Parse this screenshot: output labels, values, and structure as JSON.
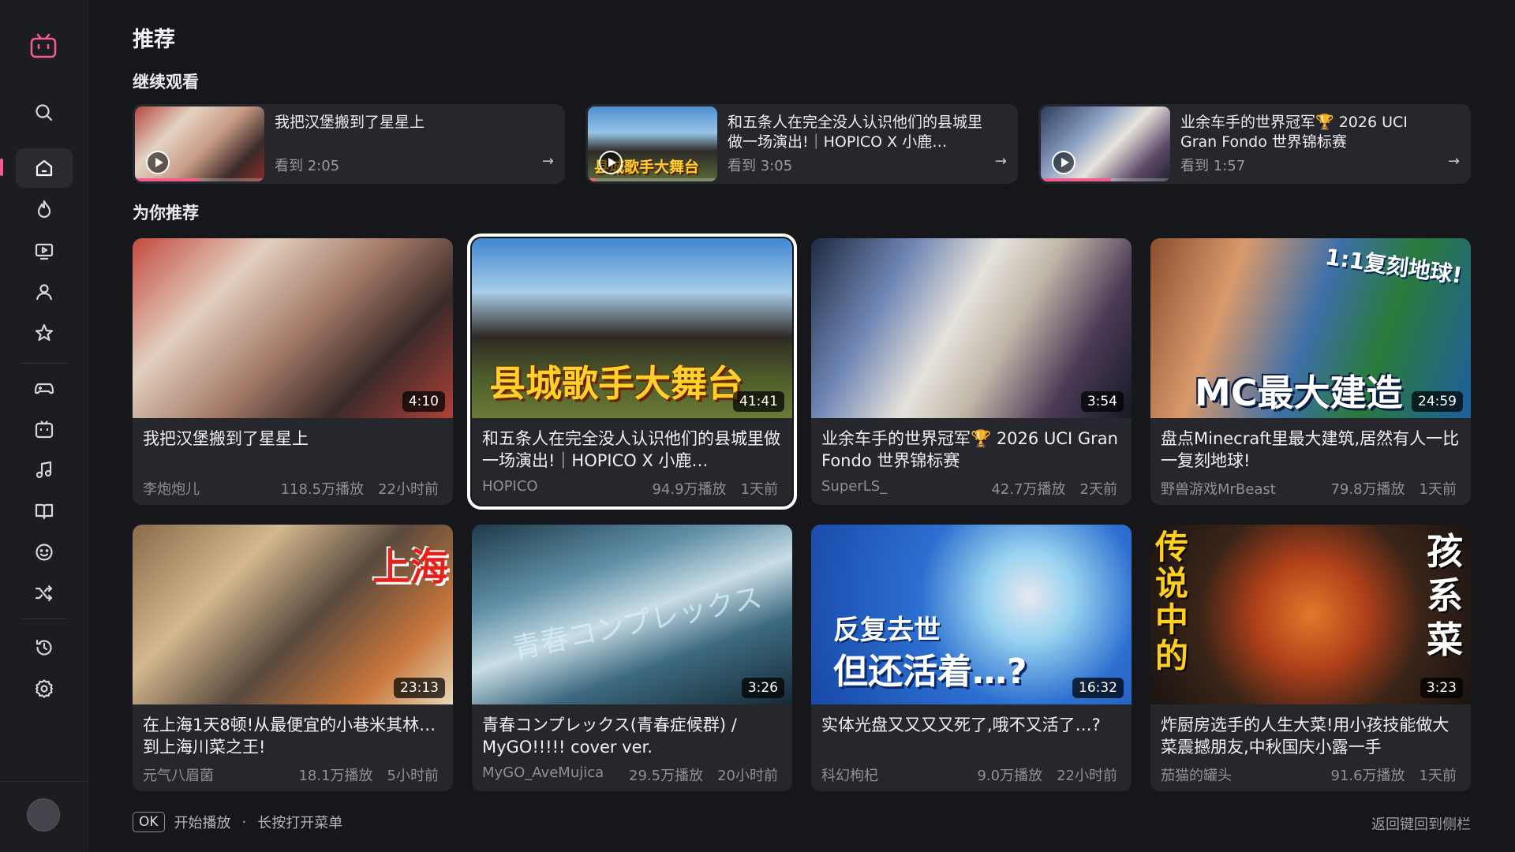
{
  "colors": {
    "background": "#16171b",
    "card": "#26272c",
    "accent": "#f25d8e",
    "focus": "#ffffff"
  },
  "sidebar": {
    "logo": "tv-logo-icon",
    "items": [
      {
        "name": "search",
        "icon": "search-icon"
      },
      {
        "name": "home",
        "icon": "home-icon",
        "active": true
      },
      {
        "name": "hot",
        "icon": "flame-icon"
      },
      {
        "name": "live",
        "icon": "live-tv-icon"
      },
      {
        "name": "following",
        "icon": "user-icon"
      },
      {
        "name": "favorites",
        "icon": "star-icon"
      },
      {
        "name": "games",
        "icon": "gamepad-icon"
      },
      {
        "name": "anime",
        "icon": "tv-icon"
      },
      {
        "name": "music",
        "icon": "music-note-icon"
      },
      {
        "name": "knowledge",
        "icon": "book-icon"
      },
      {
        "name": "fun",
        "icon": "smile-icon"
      },
      {
        "name": "random",
        "icon": "shuffle-icon"
      },
      {
        "name": "history",
        "icon": "history-icon"
      },
      {
        "name": "settings",
        "icon": "gear-icon"
      }
    ]
  },
  "page_title": "推荐",
  "continue_watching": {
    "title": "继续观看",
    "items": [
      {
        "title": "我把汉堡搬到了星星上",
        "progress_text": "看到 2:05",
        "progress": 0.5
      },
      {
        "title": "和五条人在完全没人认识他们的县城里做一场演出!｜HOPICO X 小鹿…",
        "progress_text": "看到 3:05",
        "progress": 0.06,
        "overlay": "县城歌手大舞台"
      },
      {
        "title": "业余车手的世界冠军🏆 2026 UCI Gran Fondo 世界锦标赛",
        "progress_text": "看到 1:57",
        "progress": 0.54
      }
    ]
  },
  "recommended": {
    "title": "为你推荐",
    "videos": [
      {
        "title": "我把汉堡搬到了星星上",
        "duration": "4:10",
        "uploader": "李炮炮儿",
        "views": "118.5万播放",
        "time": "22小时前"
      },
      {
        "title": "和五条人在完全没人认识他们的县城里做一场演出!｜HOPICO X 小鹿…",
        "duration": "41:41",
        "uploader": "HOPICO",
        "views": "94.9万播放",
        "time": "1天前",
        "overlay": "县城歌手大舞台",
        "focused": true
      },
      {
        "title": "业余车手的世界冠军🏆 2026 UCI Gran Fondo 世界锦标赛",
        "duration": "3:54",
        "uploader": "SuperLS_",
        "views": "42.7万播放",
        "time": "2天前"
      },
      {
        "title": "盘点Minecraft里最大建筑,居然有人一比一复刻地球!",
        "duration": "24:59",
        "uploader": "野兽游戏MrBeast",
        "views": "79.8万播放",
        "time": "1天前",
        "overlay_top": "1:1复刻地球!",
        "overlay": "MC最大建造"
      },
      {
        "title": "在上海1天8顿!从最便宜的小巷米其林…到上海川菜之王!",
        "duration": "23:13",
        "uploader": "元气八眉菌",
        "views": "18.1万播放",
        "time": "5小时前",
        "overlay": "上海"
      },
      {
        "title": "青春コンプレックス(青春症候群) / MyGO!!!!! cover ver.",
        "duration": "3:26",
        "uploader": "MyGO_AveMujica",
        "views": "29.5万播放",
        "time": "20小时前",
        "overlay": "青春コンプレックス"
      },
      {
        "title": "实体光盘又又又又死了,哦不又活了…?",
        "duration": "16:32",
        "uploader": "科幻枸杞",
        "views": "9.0万播放",
        "time": "22小时前",
        "overlay_top": "反复去世",
        "overlay": "但还活着…?"
      },
      {
        "title": "炸厨房选手的人生大菜!用小孩技能做大菜震撼朋友,中秋国庆小露一手",
        "duration": "3:23",
        "uploader": "茄猫的罐头",
        "views": "91.6万播放",
        "time": "1天前",
        "overlay_left": "传说中的",
        "overlay_right": "孩系菜"
      }
    ]
  },
  "hints": {
    "ok_key": "OK",
    "ok_action": "开始播放",
    "separator": "·",
    "long_press": "长按打开菜单",
    "back": "返回键回到侧栏"
  }
}
